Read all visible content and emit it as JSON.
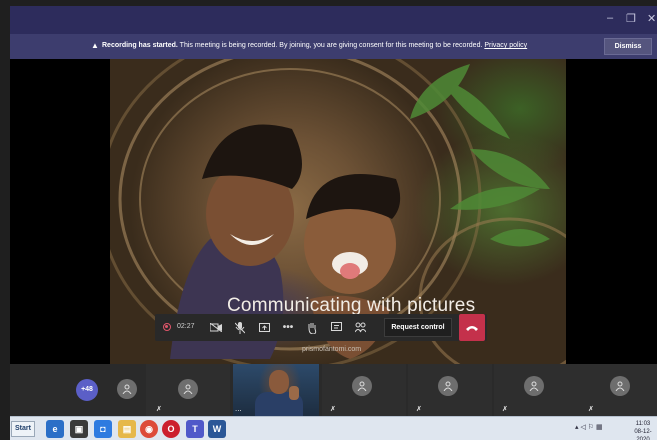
{
  "window": {
    "controls": {
      "minimize": "–",
      "maximize": "❐",
      "close": "✕"
    }
  },
  "banner": {
    "warning_icon": "warning-icon",
    "title": "Recording has started.",
    "message": " This meeting is being recorded. By joining, you are giving consent for this meeting to be recorded. ",
    "privacy_link": "Privacy policy",
    "dismiss_label": "Dismiss"
  },
  "presentation": {
    "caption": "Communicating with pictures",
    "watermark": "prismofantomi.com"
  },
  "controls": {
    "recording_timer": "02:27",
    "more_label": "•••",
    "request_control_label": "Request control",
    "accent_color": "#c4314b"
  },
  "participants": {
    "overflow_count": "+48",
    "speaker_more": "..."
  },
  "taskbar": {
    "start_label": "Start",
    "time": "11:03",
    "date": "08-12-2020"
  }
}
